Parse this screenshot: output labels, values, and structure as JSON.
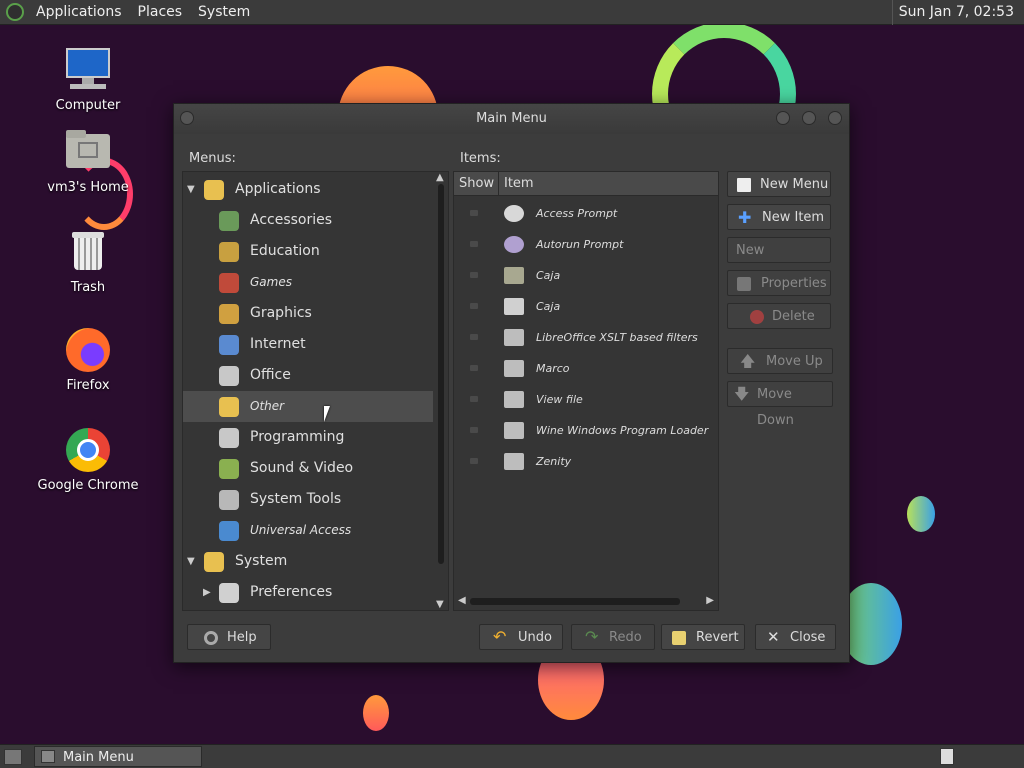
{
  "top_panel": {
    "menus": [
      "Applications",
      "Places",
      "System"
    ],
    "clock": "Sun Jan  7, 02:53"
  },
  "desktop": {
    "icons": [
      {
        "label": "Computer",
        "icon": "computer-icon"
      },
      {
        "label": "vm3's Home",
        "icon": "home-folder-icon"
      },
      {
        "label": "Trash",
        "icon": "trash-icon"
      },
      {
        "label": "Firefox",
        "icon": "firefox-icon"
      },
      {
        "label": "Google Chrome",
        "icon": "chrome-icon"
      }
    ]
  },
  "window": {
    "title": "Main Menu",
    "menus_label": "Menus:",
    "items_label": "Items:",
    "menus_tree": [
      {
        "label": "Applications",
        "level": 0,
        "expanded": true,
        "icon": "applications-icon"
      },
      {
        "label": "Accessories",
        "level": 1,
        "icon": "accessories-icon"
      },
      {
        "label": "Education",
        "level": 1,
        "icon": "education-icon"
      },
      {
        "label": "Games",
        "level": 1,
        "icon": "games-icon",
        "italic": true
      },
      {
        "label": "Graphics",
        "level": 1,
        "icon": "graphics-icon"
      },
      {
        "label": "Internet",
        "level": 1,
        "icon": "internet-icon"
      },
      {
        "label": "Office",
        "level": 1,
        "icon": "office-icon"
      },
      {
        "label": "Other",
        "level": 1,
        "icon": "other-icon",
        "italic": true,
        "selected": true
      },
      {
        "label": "Programming",
        "level": 1,
        "icon": "programming-icon"
      },
      {
        "label": "Sound & Video",
        "level": 1,
        "icon": "sound-video-icon"
      },
      {
        "label": "System Tools",
        "level": 1,
        "icon": "system-tools-icon"
      },
      {
        "label": "Universal Access",
        "level": 1,
        "icon": "universal-access-icon",
        "italic": true
      },
      {
        "label": "System",
        "level": 0,
        "expanded": true,
        "icon": "system-icon"
      },
      {
        "label": "Preferences",
        "level": 1,
        "collapsed": true,
        "icon": "preferences-icon"
      }
    ],
    "items_columns": {
      "show": "Show",
      "item": "Item"
    },
    "items": [
      {
        "label": "Access Prompt",
        "icon": "shield-icon"
      },
      {
        "label": "Autorun Prompt",
        "icon": "diamond-icon"
      },
      {
        "label": "Caja",
        "icon": "folder-icon"
      },
      {
        "label": "Caja",
        "icon": "document-icon"
      },
      {
        "label": "LibreOffice XSLT based filters",
        "icon": "window-icon"
      },
      {
        "label": "Marco",
        "icon": "window-icon"
      },
      {
        "label": "View file",
        "icon": "window-icon"
      },
      {
        "label": "Wine Windows Program Loader",
        "icon": "window-icon"
      },
      {
        "label": "Zenity",
        "icon": "window-icon"
      }
    ],
    "side_buttons": {
      "new_menu": "New Menu",
      "new_item": "New Item",
      "new_separator": "New Separator",
      "properties": "Properties",
      "delete": "Delete",
      "move_up": "Move Up",
      "move_down": "Move Down"
    },
    "bottom_buttons": {
      "help": "Help",
      "undo": "Undo",
      "redo": "Redo",
      "revert": "Revert",
      "close": "Close"
    }
  },
  "bottom_panel": {
    "task_label": "Main Menu"
  },
  "colors": {
    "desktop_bg": "#2a0d2e",
    "panel_bg": "#3b3b3b",
    "window_bg": "#3c3c3c",
    "selection": "#4d4d4d"
  }
}
